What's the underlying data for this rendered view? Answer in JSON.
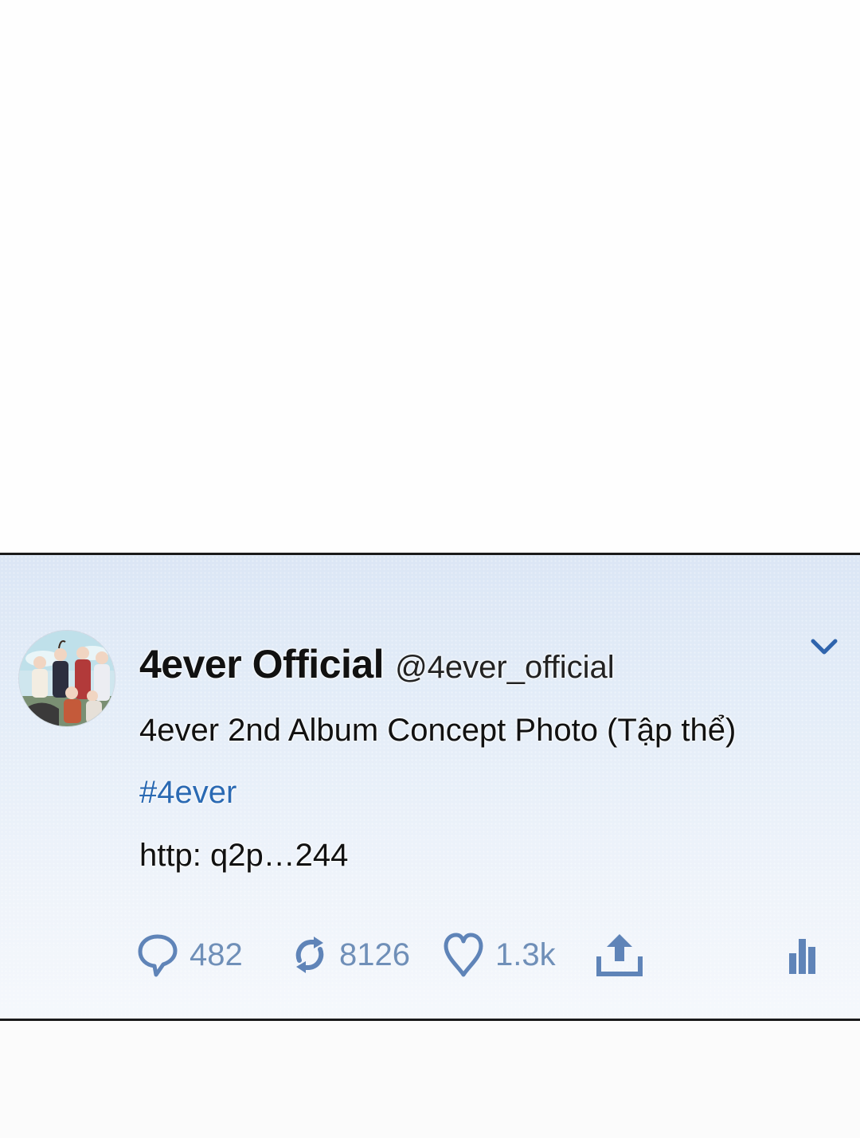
{
  "tweet": {
    "display_name": "4ever Official",
    "handle": "@4ever_official",
    "text": "4ever 2nd Album Concept Photo (Tập thể)",
    "hashtag": "#4ever",
    "link": "http: q2p…244",
    "avatar_icon": "group-photo-avatar",
    "menu_icon": "chevron-down-icon"
  },
  "actions": {
    "reply": {
      "icon": "reply-bubble-icon",
      "count": "482"
    },
    "retweet": {
      "icon": "retweet-icon",
      "count": "8126"
    },
    "like": {
      "icon": "heart-icon",
      "count": "1.3k"
    },
    "share": {
      "icon": "share-upload-icon"
    },
    "stats": {
      "icon": "bar-chart-icon"
    }
  },
  "colors": {
    "accent": "#2b6ab3",
    "icon": "#5f84b8",
    "border": "#1a1a1a"
  }
}
